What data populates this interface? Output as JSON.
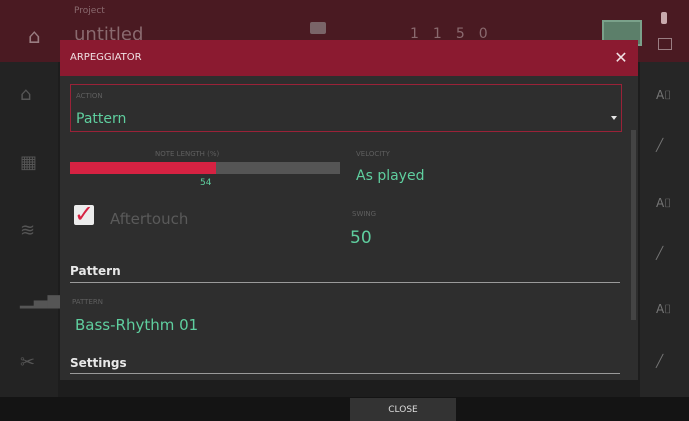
{
  "background": {
    "project_label": "Project",
    "project_title": "untitled",
    "status_numbers": [
      "1",
      "1",
      "50"
    ]
  },
  "dialog": {
    "title": "ARPEGGIATOR",
    "close_glyph": "✕",
    "action": {
      "label": "ACTION",
      "value": "Pattern"
    },
    "note_length": {
      "label": "NOTE LENGTH (%)",
      "value": "54",
      "fraction": 0.54
    },
    "velocity": {
      "label": "VELOCITY",
      "value": "As played"
    },
    "aftertouch": {
      "label": "Aftertouch",
      "checked": true
    },
    "swing": {
      "label": "SWING",
      "value": "50"
    },
    "pattern_section": {
      "title": "Pattern",
      "pattern_label": "PATTERN",
      "pattern_value": "Bass-Rhythm 01"
    },
    "settings_section": {
      "title": "Settings"
    }
  },
  "footer": {
    "close_label": "CLOSE"
  },
  "colors": {
    "accent_red": "#d62242",
    "header_red": "#8b1a30",
    "value_green": "#5fcf9f"
  },
  "icons": [
    "home-icon",
    "folder-icon",
    "usb-icon",
    "close-icon",
    "dropdown-caret-icon",
    "checkmark-icon",
    "pencil-icon"
  ]
}
